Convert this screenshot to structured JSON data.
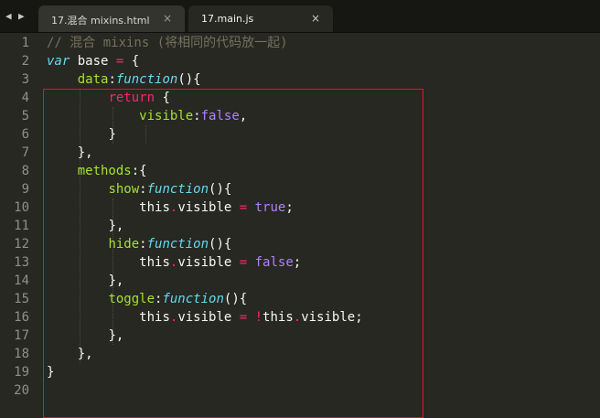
{
  "tabs": [
    {
      "label": "17.混合 mixins.html",
      "close": "×",
      "active": false
    },
    {
      "label": "17.main.js",
      "close": "×",
      "active": true
    }
  ],
  "nav": {
    "back": "◀",
    "forward": "▶"
  },
  "line_numbers": [
    "1",
    "2",
    "3",
    "4",
    "5",
    "6",
    "7",
    "8",
    "9",
    "10",
    "11",
    "12",
    "13",
    "14",
    "15",
    "16",
    "17",
    "18",
    "19",
    "20"
  ],
  "code": {
    "l1": "// 混合 mixins (将相同的代码放一起)",
    "l2": {
      "kw": "var",
      "name": " base ",
      "eq": "=",
      "rest": " {"
    },
    "l3": {
      "prop": "data",
      "colon": ":",
      "fn": "function",
      "rest": "(){"
    },
    "l4": {
      "kw": "return",
      "rest": " {"
    },
    "l5": {
      "prop": "visible",
      "colon": ":",
      "val": "false",
      "rest": ","
    },
    "l6": "}",
    "l7": "},",
    "l8": {
      "prop": "methods",
      "rest": ":{"
    },
    "l9": {
      "prop": "show",
      "colon": ":",
      "fn": "function",
      "rest": "(){"
    },
    "l10": {
      "this": "this",
      "dot": ".",
      "name": "visible ",
      "eq": "=",
      "val": " true",
      "rest": ";"
    },
    "l11": "},",
    "l12": {
      "prop": "hide",
      "colon": ":",
      "fn": "function",
      "rest": "(){"
    },
    "l13": {
      "this": "this",
      "dot": ".",
      "name": "visible ",
      "eq": "=",
      "val": " false",
      "rest": ";"
    },
    "l14": "},",
    "l15": {
      "prop": "toggle",
      "colon": ":",
      "fn": "function",
      "rest": "(){"
    },
    "l16": {
      "this": "this",
      "dot": ".",
      "name": "visible ",
      "eq": "= !",
      "this2": "this",
      "dot2": ".",
      "rest": "visible;"
    },
    "l17": "},",
    "l18": "},",
    "l19": "}",
    "l20": ""
  },
  "colors": {
    "background": "#272822",
    "comment": "#75715e",
    "keyword": "#f92672",
    "storage": "#66d9ef",
    "property": "#a6e22e",
    "constant": "#ae81ff",
    "highlight_box": "#e8141c"
  }
}
